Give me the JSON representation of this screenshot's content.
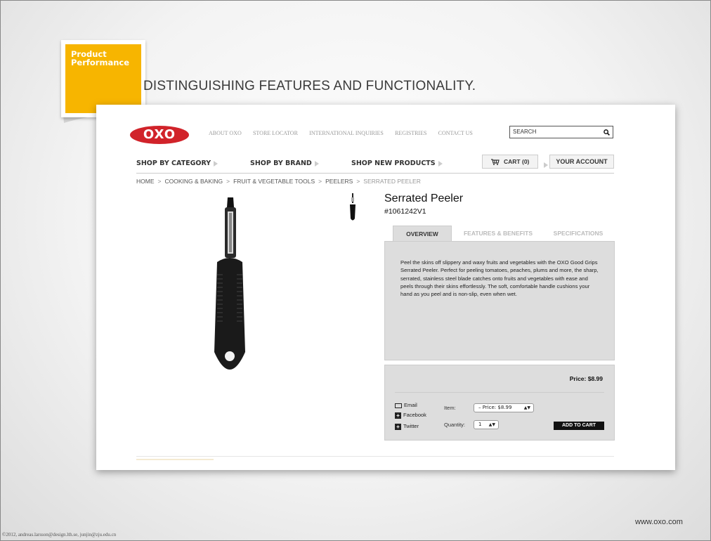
{
  "slide": {
    "tag_lines": [
      "Product",
      "Performance"
    ],
    "headline": "DISTINGUISHING FEATURES AND FUNCTIONALITY.",
    "footer_credit": "©2012, andreas.larsson@design.lth.se, junjin@zju.edu.cn",
    "footer_url": "www.oxo.com",
    "accent_color": "#f7b500"
  },
  "site": {
    "logo": "OXO",
    "brand_color": "#d1232a",
    "top_nav": [
      "ABOUT OXO",
      "STORE LOCATOR",
      "INTERNATIONAL INQUIRIES",
      "REGISTRIES",
      "CONTACT US"
    ],
    "search_placeholder": "SEARCH",
    "search_icon": "magnifier-icon",
    "shop_by_category": "SHOP BY CATEGORY",
    "shop_by_brand": "SHOP BY BRAND",
    "shop_new_products": "SHOP NEW PRODUCTS",
    "cart_label": "CART",
    "cart_count": "(0)",
    "your_account": "YOUR ACCOUNT",
    "breadcrumb": [
      "HOME",
      "COOKING & BAKING",
      "FRUIT & VEGETABLE TOOLS",
      "PEELERS",
      "SERRATED PEELER"
    ],
    "breadcrumb_sep": ">"
  },
  "product": {
    "title": "Serrated Peeler",
    "sku": "#1061242V1",
    "tabs": [
      "OVERVIEW",
      "FEATURES & BENEFITS",
      "SPECIFICATIONS"
    ],
    "description": "Peel the skins off slippery and waxy fruits and vegetables with the OXO Good Grips Serrated Peeler. Perfect for peeling tomatoes, peaches, plums and more, the sharp, serrated, stainless steel blade catches onto fruits and vegetables with ease and peels through their skins effortlessly. The soft, comfortable handle cushions your hand as you peel and is non-slip, even when wet.",
    "price": "Price: $8.99",
    "share": [
      "Email",
      "Facebook",
      "Twitter"
    ],
    "item_label": "Item:",
    "item_value": "– Price: $8.99",
    "quantity_label": "Quantity:",
    "quantity_value": "1",
    "add_to_cart": "ADD TO CART"
  }
}
